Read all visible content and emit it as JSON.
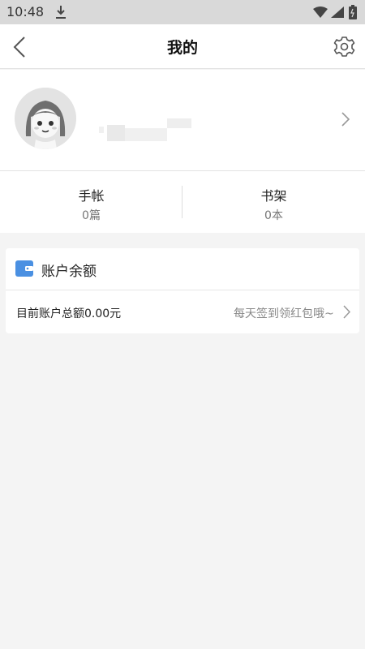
{
  "status_bar": {
    "time": "10:48",
    "icons": [
      "download-icon",
      "wifi-icon",
      "signal-icon",
      "battery-icon"
    ]
  },
  "header": {
    "title": "我的",
    "back_icon": "chevron-left-icon",
    "settings_icon": "gear-icon"
  },
  "profile": {
    "avatar_icon": "cartoon-girl-avatar",
    "chevron_icon": "chevron-right-icon"
  },
  "stats": [
    {
      "label": "手帐",
      "count": "0篇"
    },
    {
      "label": "书架",
      "count": "0本"
    }
  ],
  "account": {
    "title": "账户余额",
    "balance_text": "目前账户总额0.00元",
    "checkin_text": "每天签到领红包哦~",
    "wallet_icon": "wallet-icon",
    "accent_color": "#4a90e2"
  },
  "colors": {
    "background": "#f4f4f4",
    "surface": "#ffffff",
    "status_bar": "#d9d9d9"
  }
}
